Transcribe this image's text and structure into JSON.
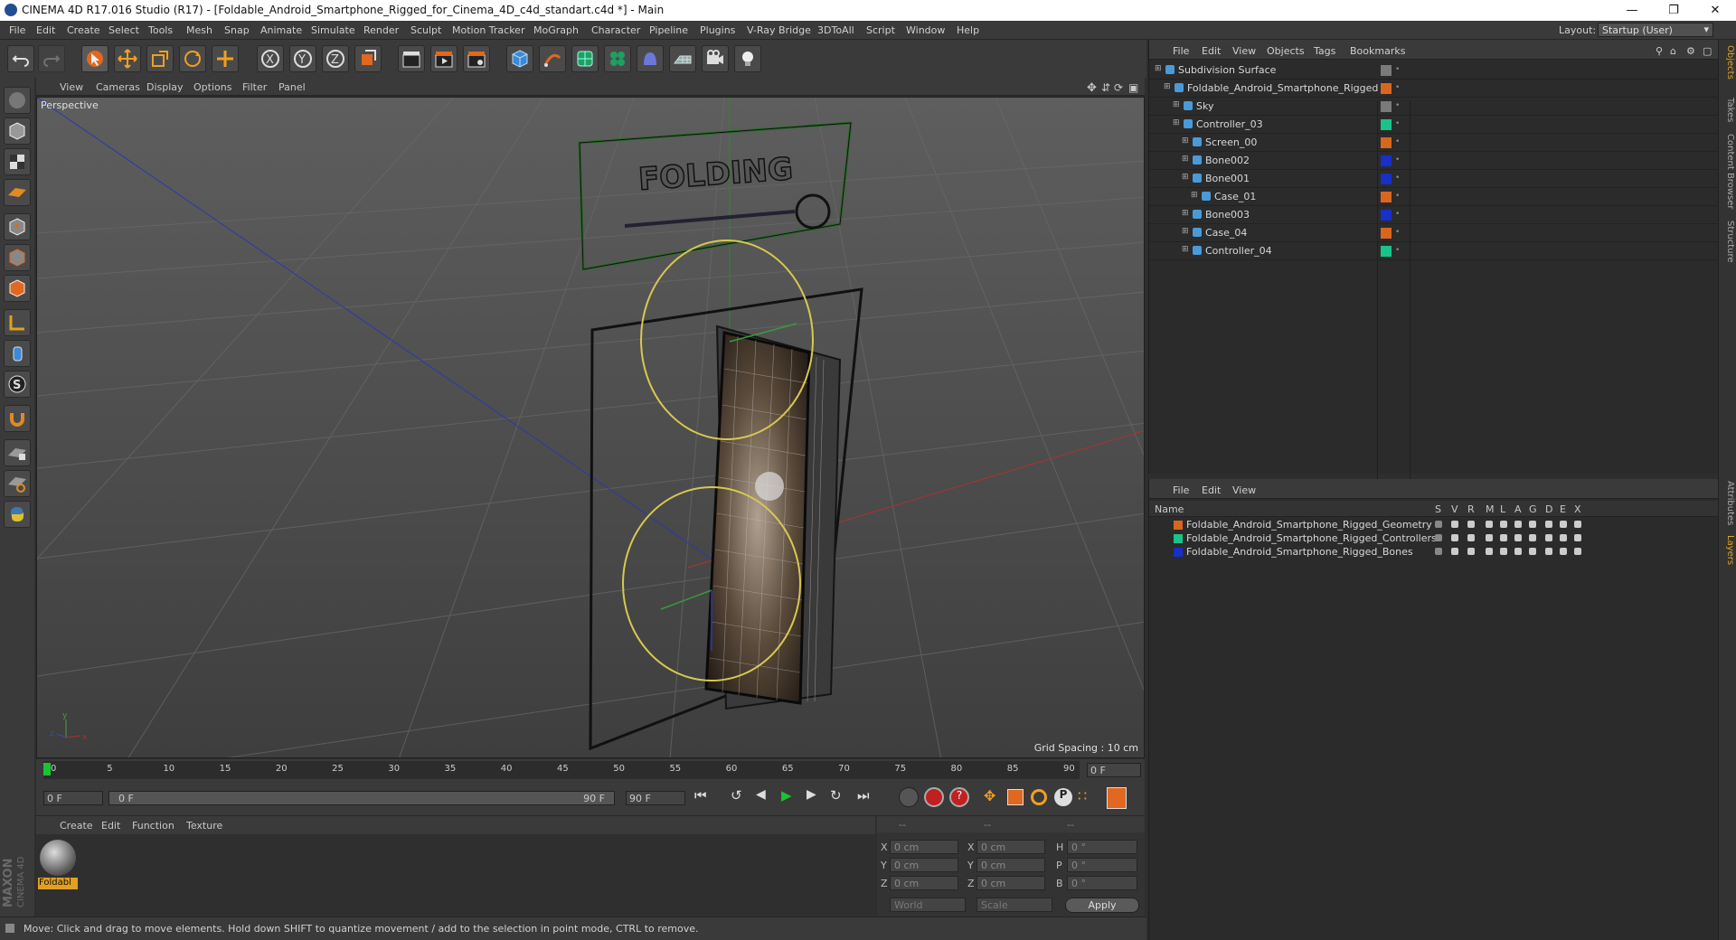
{
  "window": {
    "title": "CINEMA 4D R17.016 Studio (R17) - [Foldable_Android_Smartphone_Rigged_for_Cinema_4D_c4d_standart.c4d *] - Main"
  },
  "menubar": {
    "items": [
      "File",
      "Edit",
      "Create",
      "Select",
      "Tools",
      "Mesh",
      "Snap",
      "Animate",
      "Simulate",
      "Render",
      "Sculpt",
      "Motion Tracker",
      "MoGraph",
      "Character",
      "Pipeline",
      "Plugins",
      "V-Ray Bridge",
      "3DToAll",
      "Script",
      "Window",
      "Help"
    ],
    "layout_label": "Layout:",
    "layout_value": "Startup (User)"
  },
  "viewport": {
    "menu": [
      "View",
      "Cameras",
      "Display",
      "Options",
      "Filter",
      "Panel"
    ],
    "camera_label": "Perspective",
    "grid_spacing": "Grid Spacing : 10 cm",
    "sign_text": "FOLDING"
  },
  "timeline": {
    "ticks": [
      "0",
      "5",
      "10",
      "15",
      "20",
      "25",
      "30",
      "35",
      "40",
      "45",
      "50",
      "55",
      "60",
      "65",
      "70",
      "75",
      "80",
      "85",
      "90"
    ],
    "end_field": "0 F"
  },
  "transport": {
    "start_frame": "0 F",
    "range_left": "0 F",
    "range_right": "90 F",
    "end_frame": "90 F"
  },
  "material_manager": {
    "menu": [
      "Create",
      "Edit",
      "Function",
      "Texture"
    ],
    "material_name": "Foldabl"
  },
  "coordinates": {
    "header": [
      "--",
      "--",
      "--"
    ],
    "rows": [
      {
        "a": "X",
        "av": "0 cm",
        "b": "X",
        "bv": "0 cm",
        "c": "H",
        "cv": "0 °"
      },
      {
        "a": "Y",
        "av": "0 cm",
        "b": "Y",
        "bv": "0 cm",
        "c": "P",
        "cv": "0 °"
      },
      {
        "a": "Z",
        "av": "0 cm",
        "b": "Z",
        "bv": "0 cm",
        "c": "B",
        "cv": "0 °"
      }
    ],
    "mode1": "World",
    "mode2": "Scale",
    "apply": "Apply"
  },
  "status": {
    "text": "Move: Click and drag to move elements. Hold down SHIFT to quantize movement / add to the selection in point mode, CTRL to remove."
  },
  "object_manager": {
    "menu": [
      "File",
      "Edit",
      "View",
      "Objects",
      "Tags",
      "Bookmarks"
    ],
    "objects": [
      {
        "name": "Subdivision Surface",
        "depth": 0,
        "color": "#7a7a7a"
      },
      {
        "name": "Foldable_Android_Smartphone_Rigged",
        "depth": 1,
        "color": "#d9661f"
      },
      {
        "name": "Sky",
        "depth": 2,
        "color": "#7a7a7a"
      },
      {
        "name": "Controller_03",
        "depth": 2,
        "color": "#19c48a"
      },
      {
        "name": "Screen_00",
        "depth": 3,
        "color": "#d9661f"
      },
      {
        "name": "Bone002",
        "depth": 3,
        "color": "#1630c8"
      },
      {
        "name": "Bone001",
        "depth": 3,
        "color": "#1630c8"
      },
      {
        "name": "Case_01",
        "depth": 4,
        "color": "#d9661f"
      },
      {
        "name": "Bone003",
        "depth": 3,
        "color": "#1630c8"
      },
      {
        "name": "Case_04",
        "depth": 3,
        "color": "#d9661f"
      },
      {
        "name": "Controller_04",
        "depth": 3,
        "color": "#19c48a"
      }
    ]
  },
  "layer_manager": {
    "menu": [
      "File",
      "Edit",
      "View"
    ],
    "columns": [
      "Name",
      "S",
      "V",
      "R",
      "M",
      "L",
      "A",
      "G",
      "D",
      "E",
      "X"
    ],
    "layers": [
      {
        "name": "Foldable_Android_Smartphone_Rigged_Geometry",
        "color": "#d9661f"
      },
      {
        "name": "Foldable_Android_Smartphone_Rigged_Controllers",
        "color": "#19c48a"
      },
      {
        "name": "Foldable_Android_Smartphone_Rigged_Bones",
        "color": "#1630c8"
      }
    ]
  },
  "right_tabs": [
    "Objects",
    "Takes",
    "Content Browser",
    "Structure",
    "Attributes",
    "Layers"
  ],
  "branding": {
    "maxon": "MAXON",
    "c4d": "CINEMA 4D"
  }
}
